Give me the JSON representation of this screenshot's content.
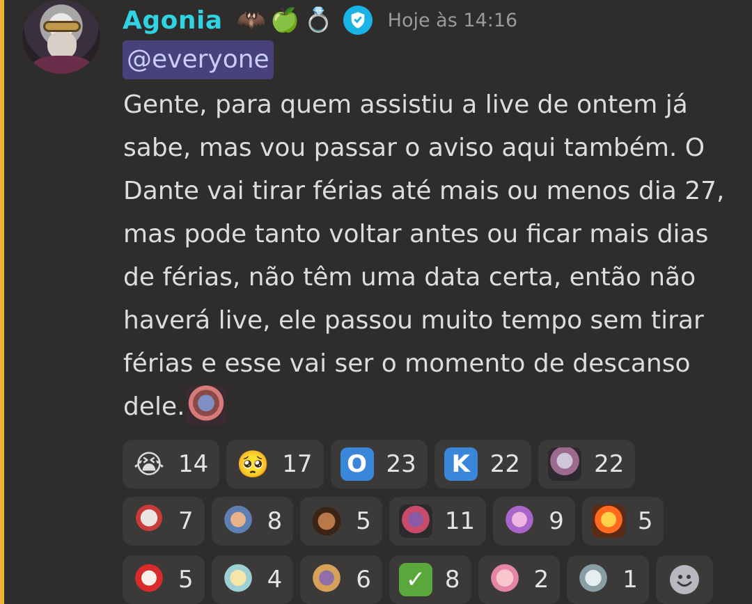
{
  "message": {
    "author": "Agonia",
    "badges": [
      "🦇",
      "🍏",
      "💍"
    ],
    "timestamp": "Hoje às 14:16",
    "mention": "@everyone",
    "text": "Gente, para quem assistiu a live de ontem já sabe, mas vou passar o aviso aqui também. O Dante vai tirar férias até mais ou menos dia 27, mas pode tanto voltar antes ou ficar mais dias de férias, não têm uma data certa, então não haverá live, ele passou muito tempo sem tirar férias e esse vai ser o momento de descanso dele."
  },
  "colors": {
    "accent_bar": "#f0b232",
    "username": "#2fd3e2",
    "mention_bg": "#48427a",
    "background": "#2e2c2b",
    "reaction_bg": "#3b3a38"
  },
  "reactions": {
    "row1": [
      {
        "icon": "😭",
        "count": "14"
      },
      {
        "icon": "🥺",
        "count": "17"
      },
      {
        "icon": "O",
        "count": "23"
      },
      {
        "icon": "K",
        "count": "22"
      },
      {
        "icon": "emote",
        "count": "22"
      }
    ],
    "row2": [
      {
        "icon": "emote",
        "count": "7"
      },
      {
        "icon": "emote",
        "count": "8"
      },
      {
        "icon": "emote",
        "count": "5"
      },
      {
        "icon": "emote",
        "count": "11"
      },
      {
        "icon": "emote",
        "count": "9"
      },
      {
        "icon": "emote",
        "count": "5"
      }
    ],
    "row3": [
      {
        "icon": "emote",
        "count": "5"
      },
      {
        "icon": "emote",
        "count": "4"
      },
      {
        "icon": "emote",
        "count": "6"
      },
      {
        "icon": "✓",
        "count": "8"
      },
      {
        "icon": "emote",
        "count": "2"
      },
      {
        "icon": "emote",
        "count": "1"
      }
    ]
  }
}
